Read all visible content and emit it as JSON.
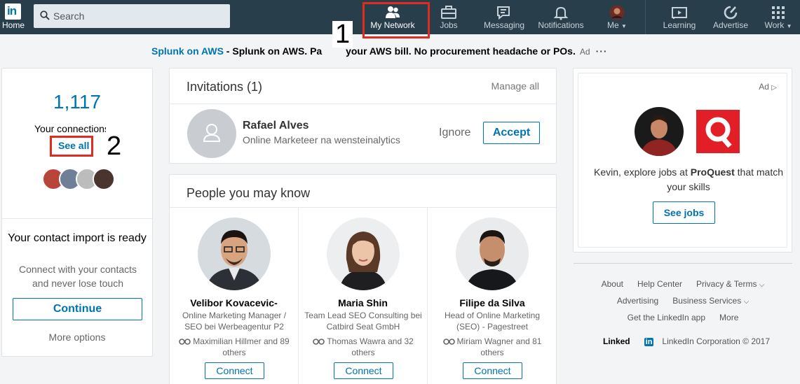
{
  "nav": {
    "home_label": "Home",
    "search_placeholder": "Search",
    "items": [
      {
        "label": "My Network",
        "icon": "people-icon"
      },
      {
        "label": "Jobs",
        "icon": "briefcase-icon"
      },
      {
        "label": "Messaging",
        "icon": "messaging-icon"
      },
      {
        "label": "Notifications",
        "icon": "bell-icon"
      },
      {
        "label": "Me",
        "icon": "avatar"
      },
      {
        "label": "Learning",
        "icon": "play-icon"
      },
      {
        "label": "Advertise",
        "icon": "compass-icon"
      },
      {
        "label": "Work",
        "icon": "grid-icon"
      }
    ]
  },
  "annotations": {
    "one": "1",
    "two": "2"
  },
  "ad_banner": {
    "brand": "Splunk on AWS",
    "text": " - Splunk on AWS. Pa",
    "text2": " your AWS bill. No procurement headache or POs.",
    "tag": "Ad",
    "dots": "···"
  },
  "connections": {
    "count": "1,117",
    "label": "Your connections",
    "see_all": "See all"
  },
  "import": {
    "title": "Your contact import is ready",
    "subtitle": "Connect with your contacts and never lose touch",
    "continue": "Continue",
    "more_options": "More options"
  },
  "invitations": {
    "title": "Invitations (1)",
    "manage_all": "Manage all",
    "name": "Rafael Alves",
    "headline": "Online Marketeer na wensteinalytics",
    "ignore": "Ignore",
    "accept": "Accept"
  },
  "pymk": {
    "title": "People you may know",
    "connect": "Connect",
    "people": [
      {
        "name": "Velibor Kovacevic-",
        "title": "Online Marketing Manager / SEO bei Werbeagentur P2",
        "mutual": "Maximilian Hillmer and 89 others"
      },
      {
        "name": "Maria Shin",
        "title": "Team Lead SEO Consulting bei Catbird Seat GmbH",
        "mutual": "Thomas Wawra and 32 others"
      },
      {
        "name": "Filipe da Silva",
        "title": "Head of Online Marketing (SEO) - Pagestreet",
        "mutual": "Miriam Wagner and 81 others"
      }
    ]
  },
  "ad_card": {
    "label": "Ad",
    "text_pre": "Kevin, explore jobs at ",
    "company": "ProQuest",
    "text_post": " that match your skills",
    "button": "See jobs"
  },
  "footer": {
    "about": "About",
    "help": "Help Center",
    "privacy": "Privacy & Terms",
    "advertising": "Advertising",
    "business": "Business Services",
    "get_app": "Get the LinkedIn app",
    "more": "More",
    "brand": "Linked",
    "brand_in": "in",
    "copyright": "LinkedIn Corporation © 2017"
  },
  "colors": {
    "nav_bg": "#283e4a",
    "accent": "#0073b1",
    "annotation": "#e02b20"
  }
}
